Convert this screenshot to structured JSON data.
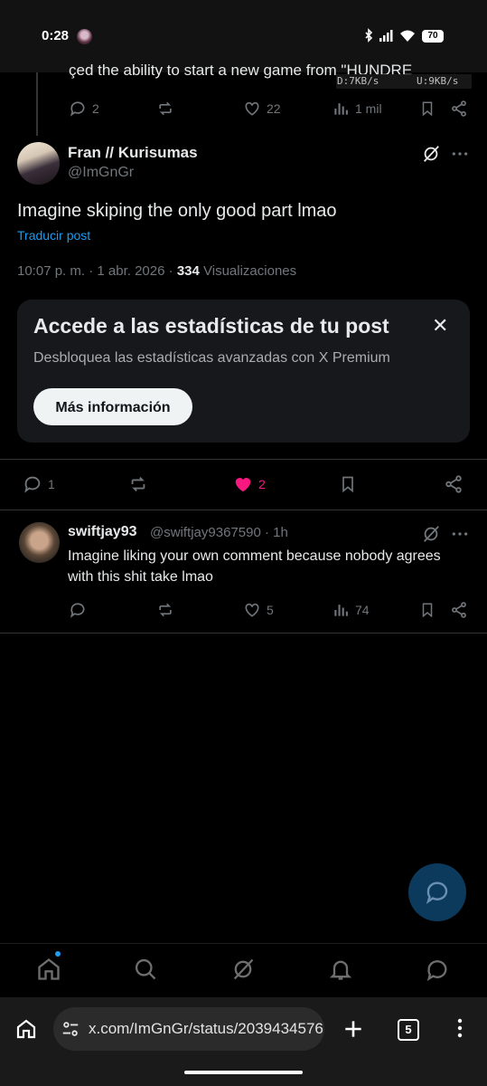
{
  "status_bar": {
    "time": "0:28",
    "battery": "70"
  },
  "prev_tweet": {
    "text_fragment": "çed the ability to start a new game from \"HUNDRE",
    "net_down": "D:7KB/s",
    "net_up": "U:9KB/s",
    "actions": {
      "replies": "2",
      "reposts": "",
      "likes": "22",
      "views": "1 mil"
    }
  },
  "tweet": {
    "author_name": "Fran // Kurisumas",
    "author_handle": "@ImGnGr",
    "text": "Imagine skiping the only good part lmao",
    "translate_label": "Traducir post",
    "time": "10:07 p. m.",
    "date": "1 abr. 2026",
    "views_count": "334",
    "views_label": "Visualizaciones",
    "actions": {
      "replies": "1",
      "likes": "2"
    }
  },
  "premium_card": {
    "title": "Accede a las estadísticas de tu post",
    "description": "Desbloquea las estadísticas avanzadas con X Premium",
    "button_label": "Más información",
    "close_symbol": "✕"
  },
  "reply": {
    "author_name": "swiftjay93",
    "author_handle": "@swiftjay9367590",
    "age": "1h",
    "text": "Imagine liking your own comment because nobody agrees with this shit take lmao",
    "actions": {
      "replies": "",
      "likes": "5",
      "views": "74"
    }
  },
  "browser": {
    "url": "x.com/ImGnGr/status/2039434576",
    "tab_count": "5"
  },
  "colors": {
    "accent": "#1d9bf0",
    "like": "#f91880",
    "muted": "#71767b",
    "text": "#e7e9ea",
    "card": "#16181c"
  },
  "icons": [
    "bluetooth-icon",
    "signal-icon",
    "wifi-icon",
    "reply-icon",
    "repost-icon",
    "like-icon",
    "views-icon",
    "bookmark-icon",
    "share-icon",
    "grok-icon",
    "more-icon",
    "compose-icon",
    "home-icon",
    "search-icon",
    "notifications-icon",
    "messages-icon",
    "site-settings-icon",
    "new-tab-icon",
    "menu-icon"
  ]
}
